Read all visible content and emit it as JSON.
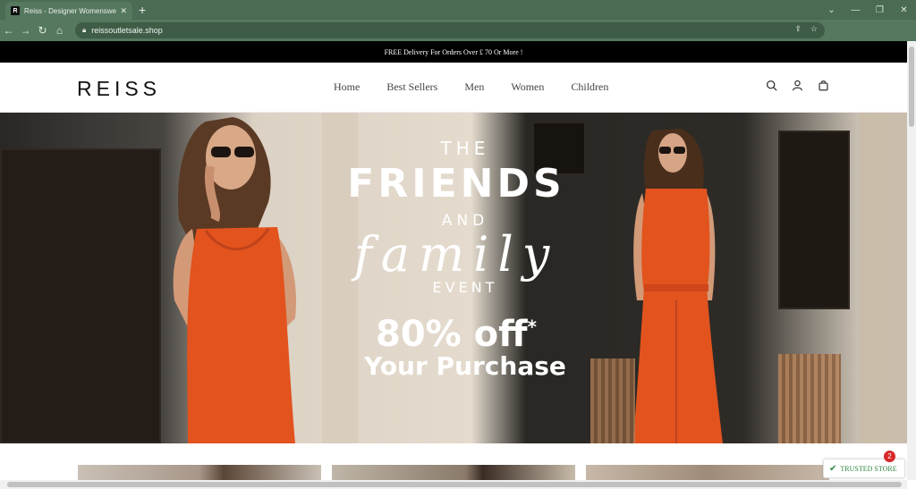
{
  "browser": {
    "tab_title": "Reiss - Designer Womenswear, I",
    "tab_favicon": "R",
    "url": "reissoutletsale.shop"
  },
  "site": {
    "promo": "FREE Delivery For Orders Over  £ 70 Or More !",
    "logo": "REISS",
    "menu": [
      "Home",
      "Best Sellers",
      "Men",
      "Women",
      "Children"
    ],
    "icons": [
      "search-icon",
      "account-icon",
      "bag-icon"
    ]
  },
  "hero": {
    "the": "THE",
    "friends": "FRIENDS",
    "and": "AND",
    "family": "family",
    "event": "EVENT",
    "offer": "80% off",
    "offer_mark": "*",
    "purchase": "Your Purchase"
  },
  "trusted": {
    "label": "TRUSTED STORE",
    "badge": "2"
  },
  "colors": {
    "chrome": "#4b6b53",
    "promo_bg": "#000000",
    "dress": "#e2531e",
    "trusted_green": "#2e8540"
  }
}
